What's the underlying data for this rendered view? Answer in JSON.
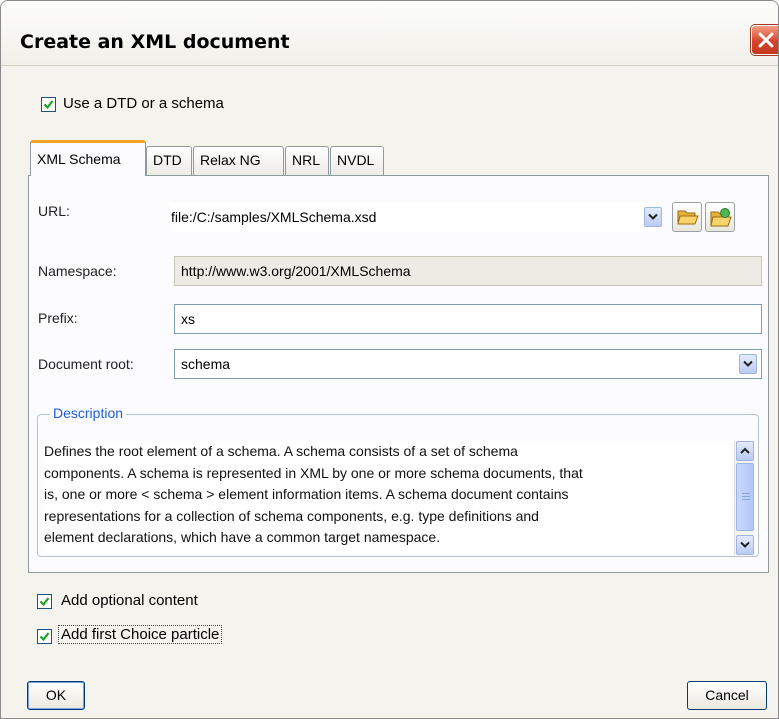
{
  "window": {
    "title": "Create an XML document"
  },
  "use_schema": {
    "label": "Use a DTD or a schema",
    "checked": true
  },
  "tabs": [
    {
      "label": "XML Schema",
      "active": true
    },
    {
      "label": "DTD",
      "active": false
    },
    {
      "label": "Relax NG",
      "active": false
    },
    {
      "label": "NRL",
      "active": false
    },
    {
      "label": "NVDL",
      "active": false
    }
  ],
  "form": {
    "url": {
      "label": "URL:",
      "value": "file:/C:/samples/XMLSchema.xsd"
    },
    "namespace": {
      "label": "Namespace:",
      "value": "http://www.w3.org/2001/XMLSchema"
    },
    "prefix": {
      "label": "Prefix:",
      "value": "xs"
    },
    "document_root": {
      "label": "Document root:",
      "value": "schema"
    }
  },
  "description": {
    "legend": "Description",
    "lines": [
      "Defines the root element of a schema. A schema consists of a set of schema",
      "components. A schema is represented in XML by one or more schema documents, that",
      "is, one or more < schema > element information items. A schema document contains",
      "representations for a collection of schema components, e.g. type definitions and",
      "element declarations, which have a common target namespace."
    ]
  },
  "options": {
    "optional_content": {
      "label": "Add optional content",
      "checked": true
    },
    "first_choice": {
      "label": "Add first Choice particle",
      "checked": true
    }
  },
  "buttons": {
    "ok": "OK",
    "cancel": "Cancel"
  },
  "icons": {
    "close": "close-icon",
    "dropdown": "chevron-down-icon",
    "browse_local": "folder-open-icon",
    "browse_url": "folder-url-icon"
  },
  "colors": {
    "dialog_bg": "#f4f3ee",
    "close_button": "#d4442a",
    "active_tab_accent": "#f4a326",
    "group_legend": "#1f5fd4",
    "checkbox_check": "#21a121"
  }
}
